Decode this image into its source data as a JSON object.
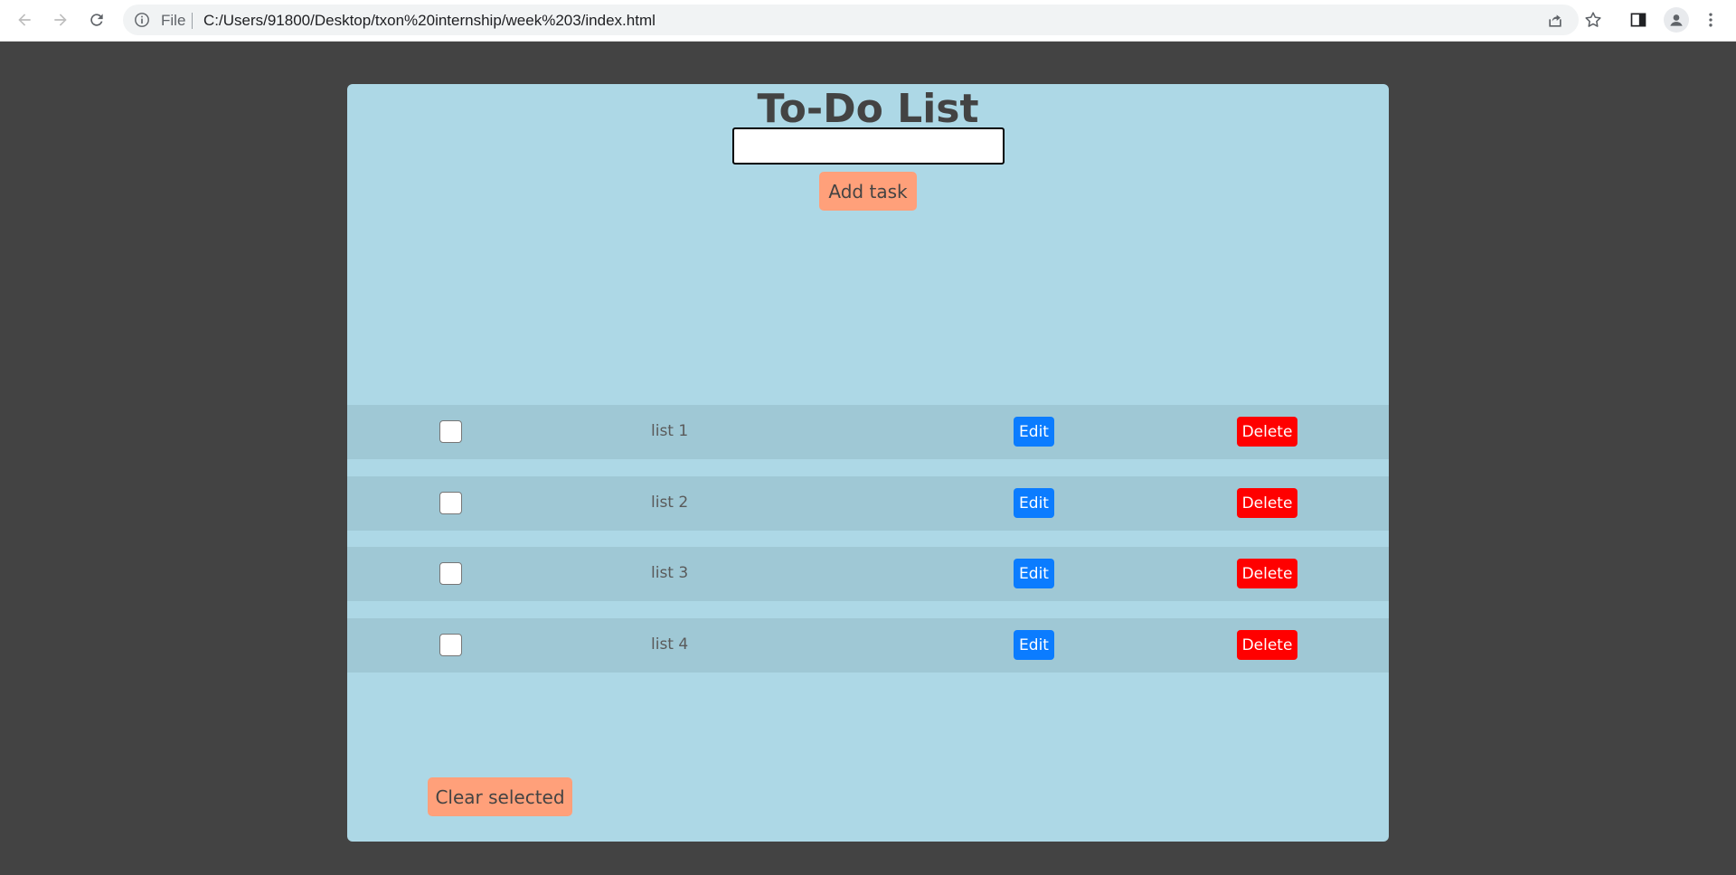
{
  "browser": {
    "file_label": "File",
    "url": "C:/Users/91800/Desktop/txon%20internship/week%203/index.html",
    "icons": [
      "back-icon",
      "forward-icon",
      "reload-icon",
      "info-icon",
      "share-icon",
      "star-icon",
      "side-panel-icon",
      "profile-icon",
      "menu-icon"
    ]
  },
  "app": {
    "title": "To-Do List",
    "input_value": "",
    "add_button": "Add task",
    "tasks": [
      {
        "label": "list 1",
        "checked": false,
        "edit": "Edit",
        "delete": "Delete"
      },
      {
        "label": "list 2",
        "checked": false,
        "edit": "Edit",
        "delete": "Delete"
      },
      {
        "label": "list 3",
        "checked": false,
        "edit": "Edit",
        "delete": "Delete"
      },
      {
        "label": "list 4",
        "checked": false,
        "edit": "Edit",
        "delete": "Delete"
      }
    ],
    "clear_button": "Clear selected"
  },
  "colors": {
    "page_background": "#434343",
    "card_background": "#add8e6",
    "row_background": "#9fc8d5",
    "accent_button": "#ffa07a",
    "edit_button": "#0b7cff",
    "delete_button": "#ff0000"
  }
}
